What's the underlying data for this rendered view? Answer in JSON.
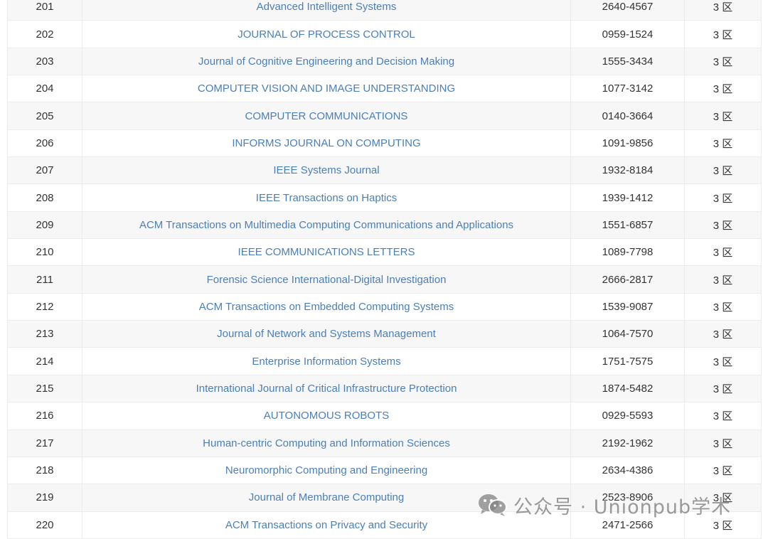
{
  "rows": [
    {
      "rank": "201",
      "name": "Advanced Intelligent Systems",
      "issn": "2640-4567",
      "zone": "3 区"
    },
    {
      "rank": "202",
      "name": "JOURNAL OF PROCESS CONTROL",
      "issn": "0959-1524",
      "zone": "3 区"
    },
    {
      "rank": "203",
      "name": "Journal of Cognitive Engineering and Decision Making",
      "issn": "1555-3434",
      "zone": "3 区"
    },
    {
      "rank": "204",
      "name": "COMPUTER VISION AND IMAGE UNDERSTANDING",
      "issn": "1077-3142",
      "zone": "3 区"
    },
    {
      "rank": "205",
      "name": "COMPUTER COMMUNICATIONS",
      "issn": "0140-3664",
      "zone": "3 区"
    },
    {
      "rank": "206",
      "name": "INFORMS JOURNAL ON COMPUTING",
      "issn": "1091-9856",
      "zone": "3 区"
    },
    {
      "rank": "207",
      "name": "IEEE Systems Journal",
      "issn": "1932-8184",
      "zone": "3 区"
    },
    {
      "rank": "208",
      "name": "IEEE Transactions on Haptics",
      "issn": "1939-1412",
      "zone": "3 区"
    },
    {
      "rank": "209",
      "name": "ACM Transactions on Multimedia Computing Communications and Applications",
      "issn": "1551-6857",
      "zone": "3 区"
    },
    {
      "rank": "210",
      "name": "IEEE COMMUNICATIONS LETTERS",
      "issn": "1089-7798",
      "zone": "3 区"
    },
    {
      "rank": "211",
      "name": "Forensic Science International-Digital Investigation",
      "issn": "2666-2817",
      "zone": "3 区"
    },
    {
      "rank": "212",
      "name": "ACM Transactions on Embedded Computing Systems",
      "issn": "1539-9087",
      "zone": "3 区"
    },
    {
      "rank": "213",
      "name": "Journal of Network and Systems Management",
      "issn": "1064-7570",
      "zone": "3 区"
    },
    {
      "rank": "214",
      "name": "Enterprise Information Systems",
      "issn": "1751-7575",
      "zone": "3 区"
    },
    {
      "rank": "215",
      "name": "International Journal of Critical Infrastructure Protection",
      "issn": "1874-5482",
      "zone": "3 区"
    },
    {
      "rank": "216",
      "name": "AUTONOMOUS ROBOTS",
      "issn": "0929-5593",
      "zone": "3 区"
    },
    {
      "rank": "217",
      "name": "Human-centric Computing and Information Sciences",
      "issn": "2192-1962",
      "zone": "3 区"
    },
    {
      "rank": "218",
      "name": "Neuromorphic Computing and Engineering",
      "issn": "2634-4386",
      "zone": "3 区"
    },
    {
      "rank": "219",
      "name": "Journal of Membrane Computing",
      "issn": "2523-8906",
      "zone": "3 区"
    },
    {
      "rank": "220",
      "name": "ACM Transactions on Privacy and Security",
      "issn": "2471-2566",
      "zone": "3 区"
    }
  ],
  "watermark": {
    "text": "公众号 · Unionpub学术",
    "icon": "wechat-icon"
  },
  "colors": {
    "link": "#4a7fb8",
    "row_stripe": "#f7f7f7",
    "text": "#333333"
  }
}
